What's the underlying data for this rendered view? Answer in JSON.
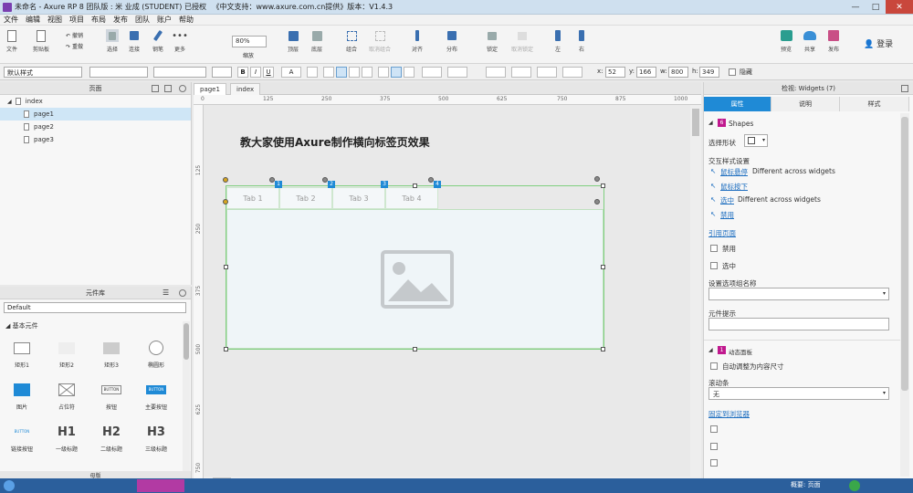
{
  "window": {
    "title": "未命名 - Axure RP 8 团队版 : 米 业成 (STUDENT) 已授权 　《中文支持：www.axure.com.cn提供》版本：V1.4.3",
    "min": "—",
    "max": "□",
    "close": "✕"
  },
  "menu": [
    "文件",
    "编辑",
    "视图",
    "项目",
    "布局",
    "发布",
    "团队",
    "账户",
    "帮助"
  ],
  "toolbar": {
    "file": "文件",
    "clipboard": "剪贴板",
    "undo": "撤销",
    "redo": "重做",
    "select": "选择",
    "connect": "连接",
    "pen": "钢笔",
    "more": "更多",
    "zoom_value": "80%",
    "zoom": "缩放",
    "top": "顶层",
    "bottom": "底层",
    "group": "组合",
    "ungroup": "取消组合",
    "align": "对齐",
    "distribute": "分布",
    "lock": "锁定",
    "unlock": "取消锁定",
    "left": "左",
    "right": "右",
    "preview": "预览",
    "share": "共享",
    "publish": "发布",
    "login": "登录"
  },
  "format": {
    "style": "默认样式",
    "x_label": "x:",
    "x": "52",
    "y_label": "y:",
    "y": "166",
    "w_label": "w:",
    "w": "800",
    "h_label": "h:",
    "h": "349",
    "hidden": "隐藏",
    "bold": "B",
    "italic": "I",
    "underline": "U",
    "text_color": "A"
  },
  "pages_panel": {
    "title": "页面",
    "root": "index",
    "pages": [
      "page1",
      "page2",
      "page3"
    ],
    "selected": "page1"
  },
  "library_panel": {
    "title": "元件库",
    "library": "Default",
    "section": "基本元件",
    "widgets": [
      "矩形1",
      "矩形2",
      "矩形3",
      "椭圆形",
      "图片",
      "占位符",
      "按钮",
      "主要按钮",
      "链接按钮",
      "一级标题",
      "二级标题",
      "三级标题"
    ],
    "btn_glyph": "BUTTON",
    "h1": "H1",
    "h2": "H2",
    "h3": "H3"
  },
  "masters_panel": {
    "title": "母版"
  },
  "doc_tabs": [
    "page1",
    "index"
  ],
  "ruler": {
    "h_ticks": [
      "0",
      "125",
      "250",
      "375",
      "500",
      "625",
      "750",
      "875",
      "1000"
    ],
    "v_ticks": [
      "125",
      "250",
      "375",
      "500",
      "625",
      "750"
    ]
  },
  "canvas": {
    "heading": "教大家使用Axure制作横向标签页效果",
    "tabs": [
      "Tab 1",
      "Tab 2",
      "Tab 3",
      "Tab 4"
    ],
    "badges": [
      "1",
      "2",
      "3",
      "4"
    ]
  },
  "inspector": {
    "title": "检视: Widgets (7)",
    "tabs": [
      "属性",
      "说明",
      "样式"
    ],
    "shapes_section": "Shapes",
    "shapes_badge": "6",
    "select_shape": "选择形状",
    "interaction_styles": "交互样式设置",
    "mouseover": "鼠标悬停",
    "mouseover_note": "Different across widgets",
    "mousedown": "鼠标按下",
    "selected": "选中",
    "selected_note": "Different across widgets",
    "disabled": "禁用",
    "ref_page": "引用页面",
    "chk_disabled": "禁用",
    "chk_selected": "选中",
    "group_name": "设置选项组名称",
    "tooltip": "元件提示",
    "dp_badge": "1",
    "dynamic_panel": "动态面板",
    "auto_fit": "自动调整为内容尺寸",
    "scrollbar": "滚动条",
    "scrollbar_value": "无",
    "pin_browser": "固定到浏览器"
  },
  "status": {
    "overview": "概要: 页面"
  },
  "colors": {
    "accent": "#1f8ad6",
    "selection": "#cfe6f6",
    "title_bar": "#cfe0ef",
    "badge_pink": "#c0188e"
  }
}
